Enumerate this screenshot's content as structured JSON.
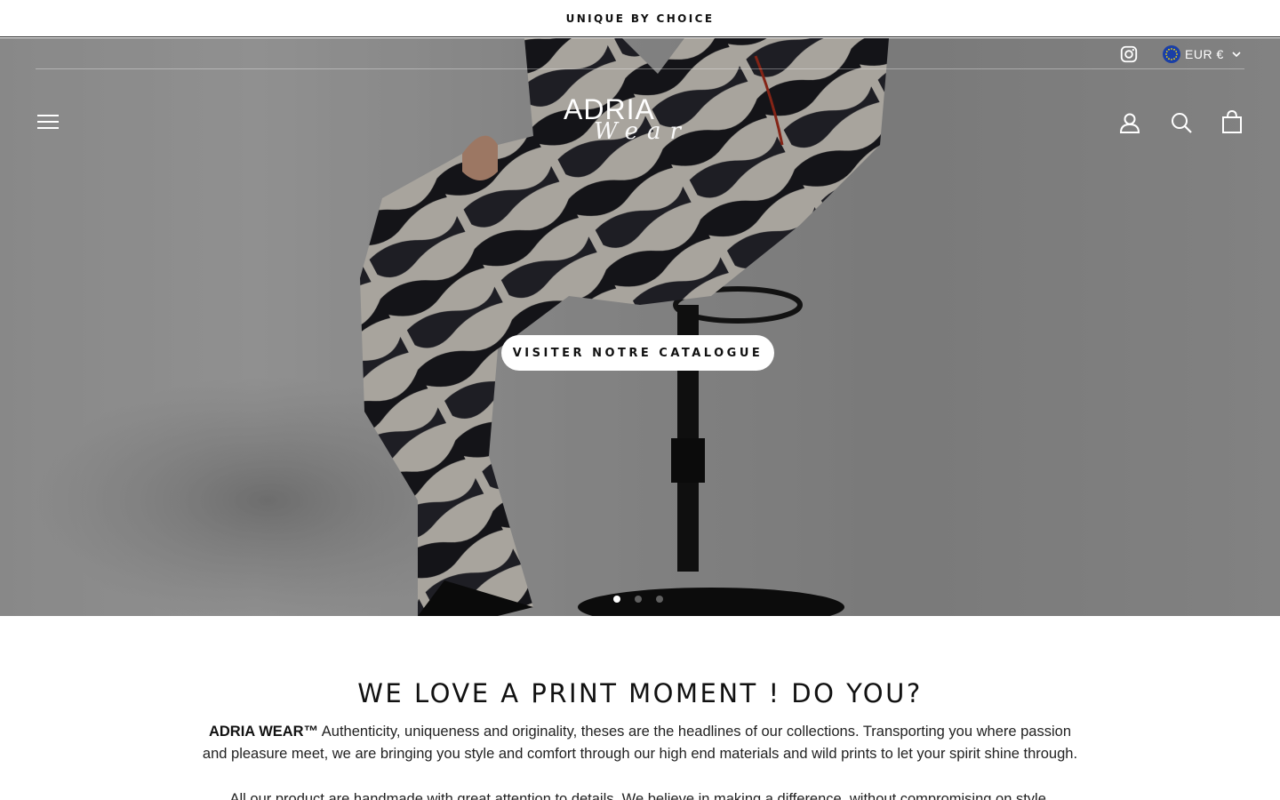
{
  "announcement": {
    "text": "UNIQUE BY CHOICE"
  },
  "header": {
    "social": {
      "instagram_icon": "instagram-icon"
    },
    "currency": {
      "label": "EUR €",
      "flag_icon": "eu-flag-icon",
      "chevron_icon": "chevron-down-icon"
    },
    "menu_icon": "hamburger-menu-icon",
    "logo": {
      "top": "ADRIA",
      "script": "Wear"
    },
    "account_icon": "account-icon",
    "search_icon": "search-icon",
    "cart_icon": "shopping-bag-icon"
  },
  "hero": {
    "cta_label": "VISITER NOTRE CATALOGUE",
    "slides_total": 3,
    "active_slide": 1
  },
  "intro": {
    "heading": "WE LOVE A PRINT MOMENT ! DO YOU?",
    "brand": "ADRIA WEAR™",
    "paragraph1": " Authenticity, uniqueness and originality, theses are the headlines of our collections. Transporting you where passion and pleasure meet, we are bringing you style and comfort through our high end materials and wild prints to let your spirit shine through.",
    "paragraph2": "All our product are handmade with great attention to details. We believe in making a difference, without compromising on style."
  },
  "colors": {
    "text": "#111111",
    "background": "#ffffff",
    "eu_blue": "#1a3fa6",
    "eu_star": "#ffdd00"
  }
}
